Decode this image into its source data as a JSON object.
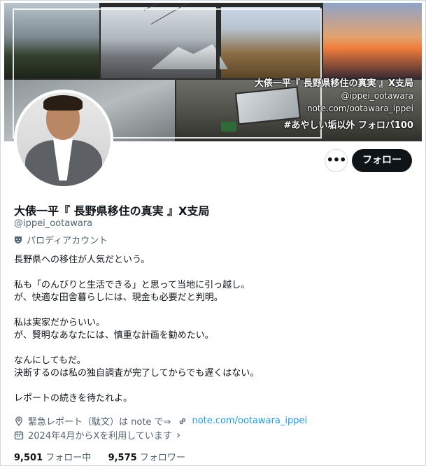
{
  "banner": {
    "line1": "大俵一平『 長野県移住の真実 』X支局",
    "line2": "@ippei_ootawara",
    "line3": "note.com/ootawara_ippei",
    "line4": "#あやしい垢以外 フォロバ100"
  },
  "actions": {
    "more_label": "•••",
    "follow_label": "フォロー"
  },
  "profile": {
    "display_name": "大俵一平『 長野県移住の真実 』X支局",
    "handle": "@ippei_ootawara",
    "parody_label": "パロディアカウント"
  },
  "bio": [
    "長野県への移住が人気だという。",
    "",
    "私も「のんびりと生活できる」と思って当地に引っ越し。",
    "が、快適な田舎暮らしには、現金も必要だと判明。",
    "",
    "私は実家だからいい。",
    "が、賢明なあなたには、慎重な計画を勧めたい。",
    "",
    "なんにしてもだ。",
    "決断するのは私の独自調査が完了してからでも遅くはない。",
    "",
    "レポートの続きを待たれよ。"
  ],
  "meta": {
    "location": "緊急レポート（駄文）は note で⇒",
    "website": "note.com/ootawara_ippei",
    "joined": "2024年4月からXを利用しています",
    "joined_chevron": "›"
  },
  "stats": {
    "following_count": "9,501",
    "following_label": "フォロー中",
    "followers_count": "9,575",
    "followers_label": "フォロワー"
  },
  "colors": {
    "link": "#1d9bf0",
    "secondary_text": "#536471",
    "follow_button_bg": "#0f1419"
  }
}
